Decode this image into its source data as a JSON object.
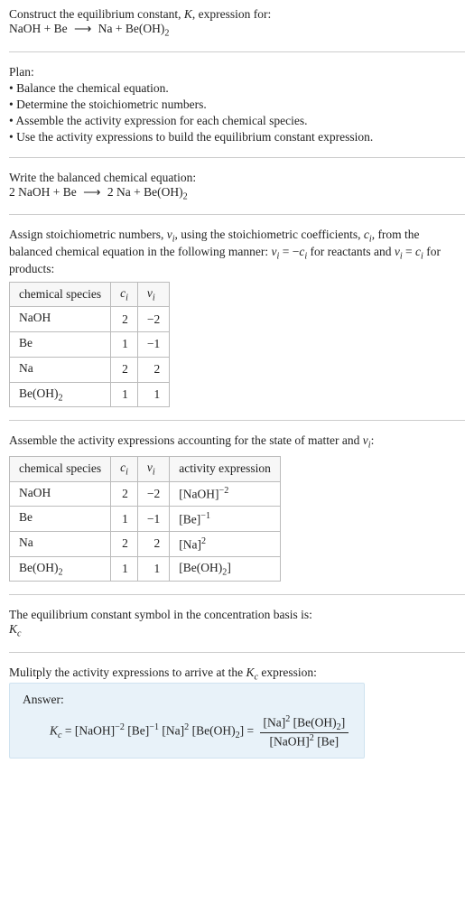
{
  "intro": {
    "line1_a": "Construct the equilibrium constant, ",
    "line1_k": "K",
    "line1_b": ", expression for:"
  },
  "unbalanced": {
    "r1": "NaOH",
    "plus": " + ",
    "r2": "Be",
    "arrow": "⟶",
    "p1": "Na",
    "p2_main": "Be(OH)",
    "p2_sub": "2"
  },
  "plan": {
    "heading": "Plan:",
    "items": [
      "• Balance the chemical equation.",
      "• Determine the stoichiometric numbers.",
      "• Assemble the activity expression for each chemical species.",
      "• Use the activity expressions to build the equilibrium constant expression."
    ]
  },
  "balanced": {
    "heading": "Write the balanced chemical equation:",
    "c1": "2 ",
    "r1": "NaOH",
    "plus": " + ",
    "r2": "Be",
    "arrow": "⟶",
    "c2": "2 ",
    "p1": "Na",
    "p2_main": "Be(OH)",
    "p2_sub": "2"
  },
  "stoich_text": {
    "a": "Assign stoichiometric numbers, ",
    "nu": "ν",
    "nu_sub": "i",
    "b": ", using the stoichiometric coefficients, ",
    "c": "c",
    "c_sub": "i",
    "d": ", from the balanced chemical equation in the following manner: ",
    "rel1_l": "ν",
    "rel1_ls": "i",
    "rel1_eq": " = −",
    "rel1_r": "c",
    "rel1_rs": "i",
    "e": " for reactants and ",
    "rel2_l": "ν",
    "rel2_ls": "i",
    "rel2_eq": " = ",
    "rel2_r": "c",
    "rel2_rs": "i",
    "f": " for products:"
  },
  "table1": {
    "h1": "chemical species",
    "h2_a": "c",
    "h2_b": "i",
    "h3_a": "ν",
    "h3_b": "i",
    "rows": [
      {
        "sp_a": "NaOH",
        "sp_sub": "",
        "c": "2",
        "nu": "−2"
      },
      {
        "sp_a": "Be",
        "sp_sub": "",
        "c": "1",
        "nu": "−1"
      },
      {
        "sp_a": "Na",
        "sp_sub": "",
        "c": "2",
        "nu": "2"
      },
      {
        "sp_a": "Be(OH)",
        "sp_sub": "2",
        "c": "1",
        "nu": "1"
      }
    ]
  },
  "activity_text": {
    "a": "Assemble the activity expressions accounting for the state of matter and ",
    "nu": "ν",
    "nu_sub": "i",
    "b": ":"
  },
  "table2": {
    "h1": "chemical species",
    "h2_a": "c",
    "h2_b": "i",
    "h3_a": "ν",
    "h3_b": "i",
    "h4": "activity expression",
    "rows": [
      {
        "sp_a": "NaOH",
        "sp_sub": "",
        "c": "2",
        "nu": "−2",
        "ae_l": "[NaOH]",
        "ae_sup": "−2",
        "ae_sub": ""
      },
      {
        "sp_a": "Be",
        "sp_sub": "",
        "c": "1",
        "nu": "−1",
        "ae_l": "[Be]",
        "ae_sup": "−1",
        "ae_sub": ""
      },
      {
        "sp_a": "Na",
        "sp_sub": "",
        "c": "2",
        "nu": "2",
        "ae_l": "[Na]",
        "ae_sup": "2",
        "ae_sub": ""
      },
      {
        "sp_a": "Be(OH)",
        "sp_sub": "2",
        "c": "1",
        "nu": "1",
        "ae_l": "[Be(OH)",
        "ae_sup": "",
        "ae_sub": "2",
        "ae_r": "]"
      }
    ]
  },
  "basis": {
    "line": "The equilibrium constant symbol in the concentration basis is:",
    "k": "K",
    "ksub": "c"
  },
  "multiply": {
    "a": "Mulitply the activity expressions to arrive at the ",
    "k": "K",
    "ksub": "c",
    "b": " expression:"
  },
  "answer": {
    "label": "Answer:",
    "k": "K",
    "ksub": "c",
    "eq": " = ",
    "t1": "[NaOH]",
    "t1s": "−2",
    "t2": "[Be]",
    "t2s": "−1",
    "t3": "[Na]",
    "t3s": "2",
    "t4a": "[Be(OH)",
    "t4sub": "2",
    "t4b": "]",
    "eq2": " = ",
    "num_a": "[Na]",
    "num_as": "2",
    "num_b1": "[Be(OH)",
    "num_bsub": "2",
    "num_b2": "]",
    "den_a": "[NaOH]",
    "den_as": "2",
    "den_b": "[Be]"
  }
}
